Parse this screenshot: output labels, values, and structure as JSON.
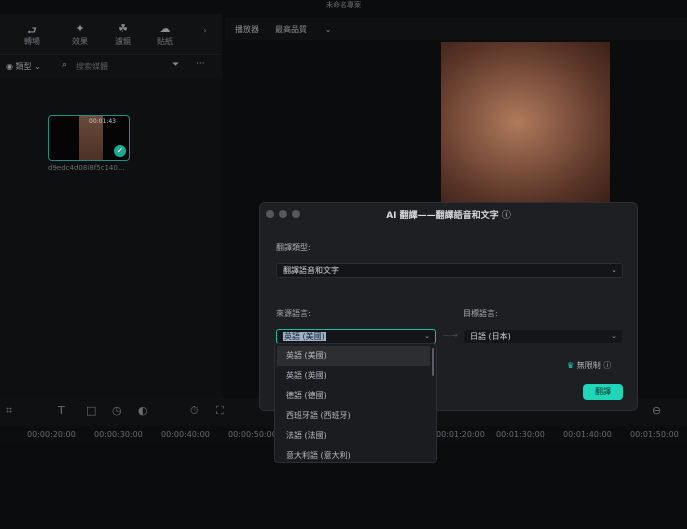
{
  "app": {
    "title": "未命名專案"
  },
  "toolbar": {
    "items": [
      {
        "label": "轉場",
        "icon": "transition-icon"
      },
      {
        "label": "效果",
        "icon": "effects-icon"
      },
      {
        "label": "濾鏡",
        "icon": "filter-icon"
      },
      {
        "label": "貼紙",
        "icon": "sticker-icon"
      }
    ]
  },
  "media": {
    "filter_label": "類型",
    "search_placeholder": "搜索媒體",
    "clip": {
      "duration": "00:01:43",
      "name": "d9edc4d08i8f5c140..."
    }
  },
  "player": {
    "label": "播放器",
    "quality": "最高品質"
  },
  "dialog": {
    "title": "AI 翻譯——翻譯語音和文字",
    "type_label": "翻譯類型:",
    "type_value": "翻譯語音和文字",
    "source_label": "來源語言:",
    "source_value": "英語 (美國)",
    "target_label": "目標語言:",
    "target_value": "日語 (日本)",
    "unlimited": "無限制",
    "ok": "翻譯"
  },
  "dropdown": {
    "options": [
      "英語 (美國)",
      "英語 (英國)",
      "德語 (德國)",
      "西班牙語 (西班牙)",
      "法語 (法國)",
      "意大利語 (意大利)"
    ]
  },
  "timeline": {
    "ticks": [
      "00:00:20:00",
      "00:00:30:00",
      "00:00:40:00",
      "00:00:50:00",
      "00:01:20:00",
      "00:01:30:00",
      "00:01:40:00",
      "00:01:50:00"
    ]
  },
  "colors": {
    "accent": "#1fd6b8"
  }
}
